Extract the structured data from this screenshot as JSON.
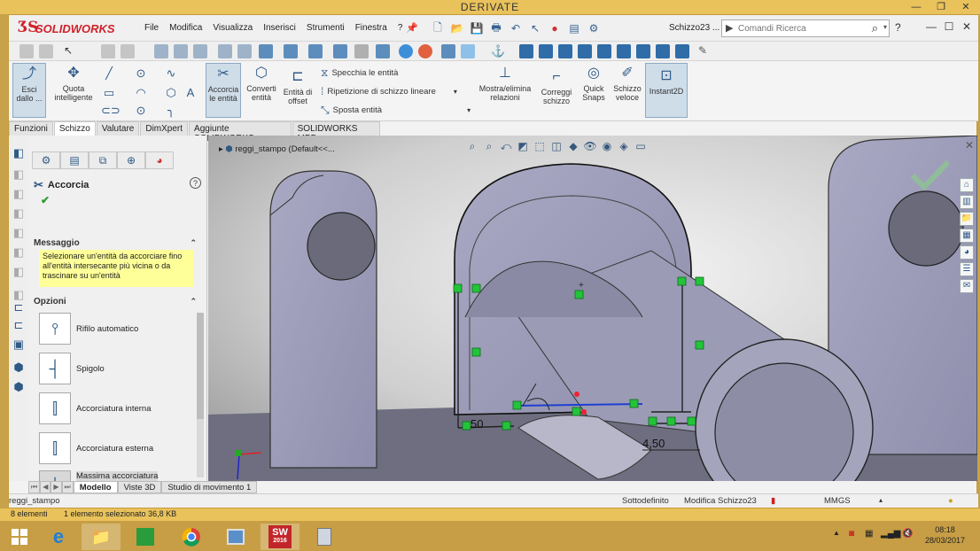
{
  "outer_window": {
    "title": "DERIVATE"
  },
  "app": {
    "logo_text": "SOLIDWORKS",
    "document_title": "Schizzo23 ...",
    "accent": "#d0202a"
  },
  "menu": {
    "items": [
      "File",
      "Modifica",
      "Visualizza",
      "Inserisci",
      "Strumenti",
      "Finestra",
      "?"
    ]
  },
  "search": {
    "placeholder": "Comandi Ricerca"
  },
  "help_label": "?",
  "ribbon": {
    "exit_sketch": "Esci dallo ...",
    "smart_dim": "Quota intelligente",
    "trim": "Accorcia le entità",
    "convert": "Converti entità",
    "offset": "Entità di offset",
    "mirror": "Specchia le entità",
    "pattern": "Ripetizione di schizzo lineare",
    "move": "Sposta entità",
    "relations": "Mostra/elimina relazioni",
    "repair": "Correggi schizzo",
    "quick_snaps": "Quick Snaps",
    "rapid_sketch": "Schizzo veloce",
    "instant2d": "Instant2D"
  },
  "tabs": [
    "Funzioni",
    "Schizzo",
    "Valutare",
    "DimXpert",
    "Aggiunte SOLIDWORKS",
    "SOLIDWORKS MBD"
  ],
  "property_manager": {
    "title": "Accorcia",
    "message_header": "Messaggio",
    "message": "Selezionare un'entità da accorciare fino all'entità intersecante più vicina o da trascinare su un'entità",
    "options_header": "Opzioni",
    "options": [
      "Rifilo automatico",
      "Spigolo",
      "Accorciatura interna",
      "Accorciatura esterna",
      "Massima accorciatura"
    ]
  },
  "graphics": {
    "tree_label": "reggi_stampo  (Default<<...",
    "dims": [
      "50",
      "4,50"
    ]
  },
  "bottom_tabs": [
    "Modello",
    "Viste 3D",
    "Studio di movimento 1"
  ],
  "status": {
    "part": "reggi_stampo",
    "state": "Sottodefinito",
    "editing": "Modifica Schizzo23",
    "units": "MMGS"
  },
  "explorer_status": {
    "items": "8 elementi",
    "selection": "1 elemento selezionato  36,8 KB"
  },
  "taskbar": {
    "time": "08:18",
    "date": "28/03/2017",
    "sw_badge": "2016"
  }
}
